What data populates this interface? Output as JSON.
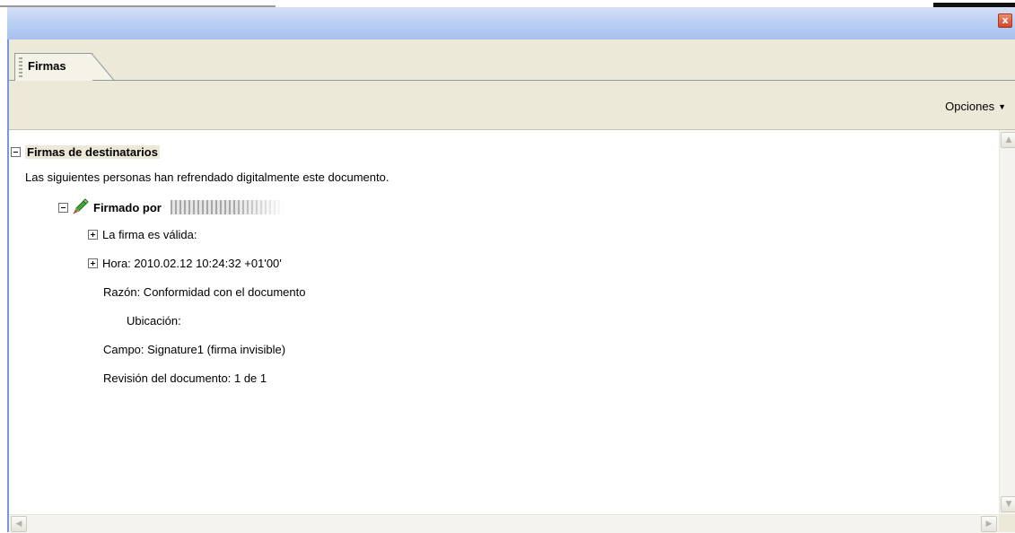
{
  "window": {
    "close_glyph": "x"
  },
  "tabs": [
    {
      "label": "Firmas"
    }
  ],
  "toolbar": {
    "options_label": "Opciones"
  },
  "tree": {
    "section_title": "Firmas de destinatarios",
    "description": "Las siguientes personas han refrendado digitalmente este documento.",
    "signature": {
      "signed_by_label": "Firmado por",
      "validity": "La firma es válida:",
      "time": "Hora: 2010.02.12 10:24:32 +01'00'",
      "reason": "Razón: Conformidad con el documento",
      "location": "Ubicación:",
      "field": "Campo: Signature1 (firma invisible)",
      "revision": "Revisión del documento: 1 de 1"
    }
  },
  "icons": {
    "close": "close-icon",
    "signature": "signature-pen-icon",
    "dropdown": "chevron-down-icon",
    "scroll_up": "scroll-up-arrow-icon",
    "scroll_down": "scroll-down-arrow-icon",
    "scroll_left": "scroll-left-arrow-icon",
    "scroll_right": "scroll-right-arrow-icon"
  },
  "colors": {
    "titlebar": "#bcd0f4",
    "panel_bg": "#ece9d8",
    "close_button": "#d2462a",
    "section_highlight": "#ece9d8"
  }
}
